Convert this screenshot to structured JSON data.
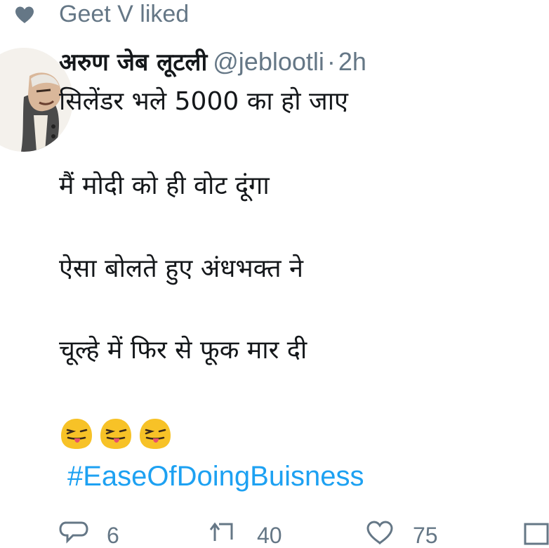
{
  "social_context": {
    "text": "Geet V liked",
    "icon": "heart-icon"
  },
  "tweet": {
    "display_name": "अरुण जेब लूटली",
    "handle": "@jeblootli",
    "separator": "·",
    "time": "2h",
    "lines": [
      "सिलेंडर भले 5000 का हो जाए",
      "मैं मोदी को ही वोट दूंगा",
      "ऐसा बोलते हुए अंधभक्त ने",
      "चूल्हे में फिर से फूक मार दी"
    ],
    "emojis": [
      "face-with-stuck-out-tongue-and-winking-eye",
      "face-with-stuck-out-tongue-and-winking-eye",
      "face-with-stuck-out-tongue-and-winking-eye"
    ],
    "hashtag": "#EaseOfDoingBuisness"
  },
  "actions": {
    "reply_count": "6",
    "retweet_count": "40",
    "like_count": "75"
  },
  "colors": {
    "text_primary": "#14171a",
    "text_secondary": "#657786",
    "link": "#1da1f2",
    "emoji_yellow": "#f7c227"
  }
}
